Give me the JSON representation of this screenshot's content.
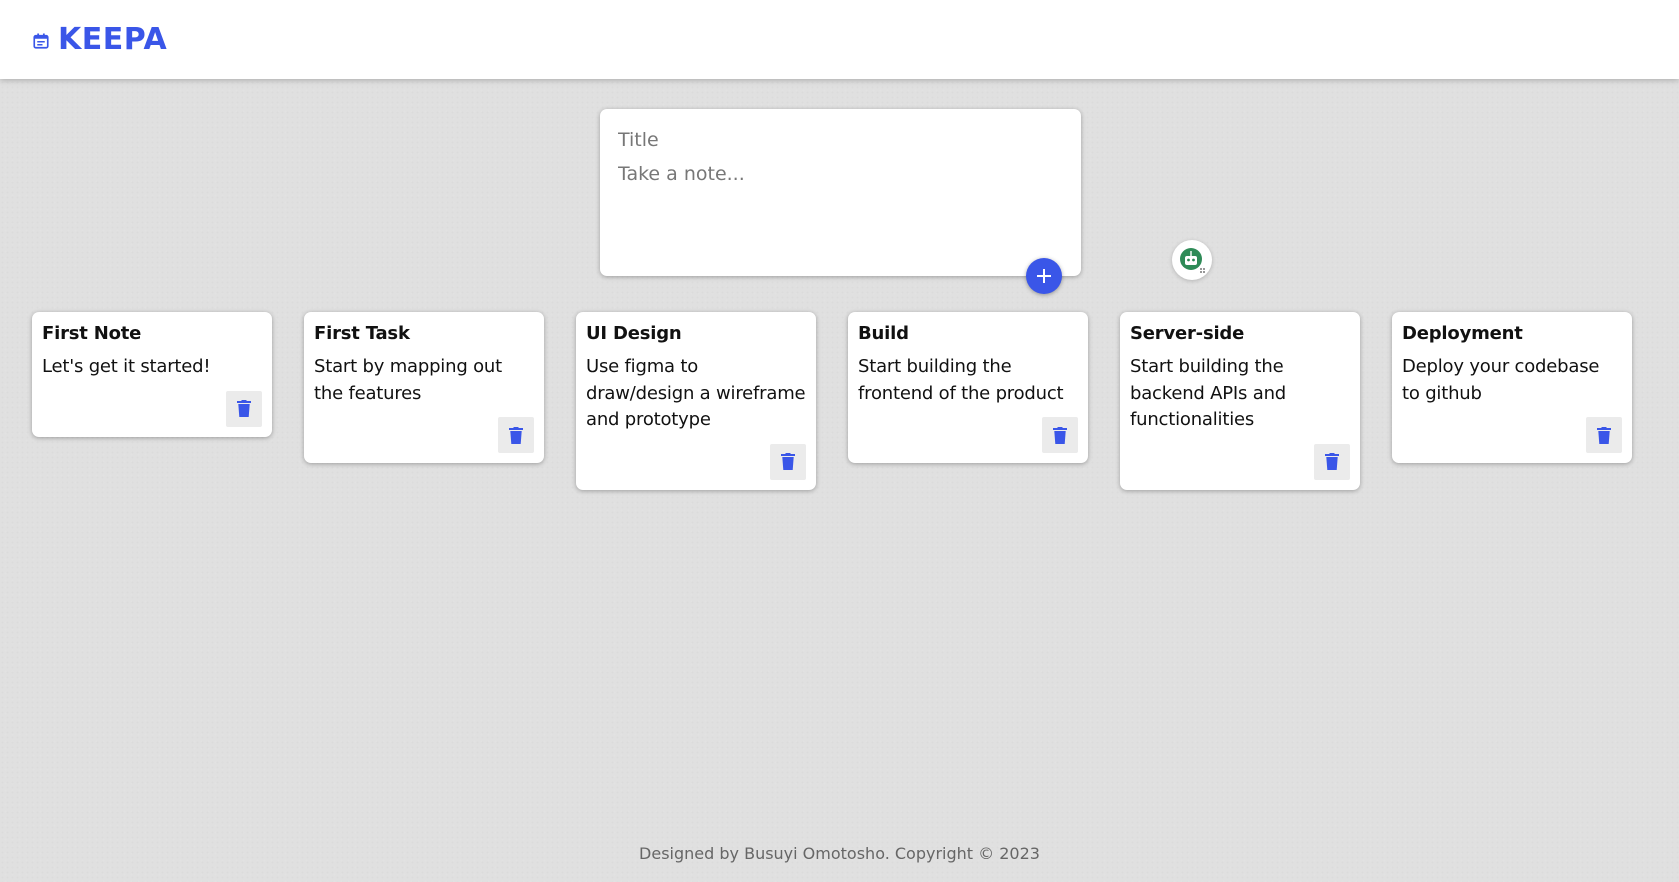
{
  "header": {
    "logo_icon": "calendar-note-icon",
    "title": "KEEPA"
  },
  "composer": {
    "title_placeholder": "Title",
    "content_placeholder": "Take a note...",
    "add_icon": "plus-icon"
  },
  "notes": [
    {
      "title": "First Note",
      "content": "Let's get it started!"
    },
    {
      "title": "First Task",
      "content": "Start by mapping out the features"
    },
    {
      "title": "UI Design",
      "content": "Use figma to draw/design a wireframe and prototype"
    },
    {
      "title": "Build",
      "content": "Start building the frontend of the product"
    },
    {
      "title": "Server-side",
      "content": "Start building the backend APIs and functionalities"
    },
    {
      "title": "Deployment",
      "content": "Deploy your codebase to github"
    }
  ],
  "delete_icon": "trash-icon",
  "footer": {
    "text": "Designed by Busuyi Omotosho. Copyright © 2023"
  },
  "colors": {
    "accent": "#3a56e8",
    "background": "#e0e0e0",
    "card": "#ffffff"
  }
}
